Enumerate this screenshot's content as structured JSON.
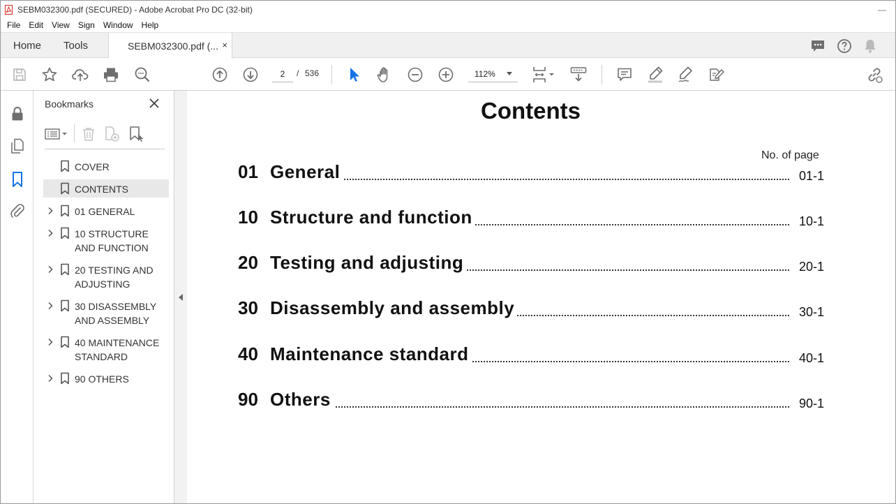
{
  "window": {
    "title": "SEBM032300.pdf (SECURED) - Adobe Acrobat Pro DC (32-bit)",
    "controls": {
      "minimize": "—"
    }
  },
  "menu": [
    "File",
    "Edit",
    "View",
    "Sign",
    "Window",
    "Help"
  ],
  "tabs": {
    "home": "Home",
    "tools": "Tools",
    "document": "SEBM032300.pdf (...",
    "close": "×"
  },
  "toolbar": {
    "page_current": "2",
    "page_separator": "/",
    "page_total": "536",
    "zoom": "112%"
  },
  "bookmarks": {
    "header": "Bookmarks",
    "items": [
      {
        "label": "COVER",
        "expandable": false,
        "selected": false
      },
      {
        "label": "CONTENTS",
        "expandable": false,
        "selected": true
      },
      {
        "label": "01 GENERAL",
        "expandable": true,
        "selected": false
      },
      {
        "label": "10 STRUCTURE AND FUNCTION",
        "expandable": true,
        "selected": false
      },
      {
        "label": "20 TESTING AND ADJUSTING",
        "expandable": true,
        "selected": false
      },
      {
        "label": "30 DISASSEMBLY AND ASSEMBLY",
        "expandable": true,
        "selected": false
      },
      {
        "label": "40 MAINTENANCE STANDARD",
        "expandable": true,
        "selected": false
      },
      {
        "label": "90 OTHERS",
        "expandable": true,
        "selected": false
      }
    ]
  },
  "document": {
    "title": "Contents",
    "page_column_label": "No. of page",
    "toc": [
      {
        "num": "01",
        "title": "General",
        "page": "01-1"
      },
      {
        "num": "10",
        "title": "Structure and function",
        "page": "10-1"
      },
      {
        "num": "20",
        "title": "Testing and adjusting",
        "page": "20-1"
      },
      {
        "num": "30",
        "title": "Disassembly and assembly",
        "page": "30-1"
      },
      {
        "num": "40",
        "title": "Maintenance standard",
        "page": "40-1"
      },
      {
        "num": "90",
        "title": "Others",
        "page": "90-1"
      }
    ]
  },
  "colors": {
    "accent_blue": "#1473e6",
    "app_red": "#d7261e",
    "icon_gray": "#707070"
  }
}
